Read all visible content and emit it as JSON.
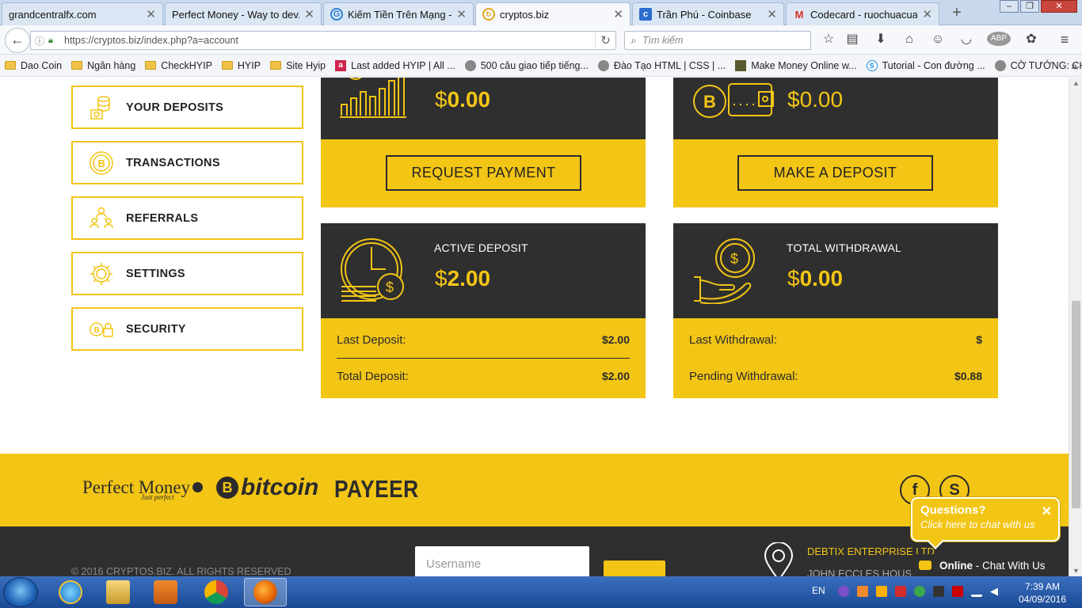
{
  "browser": {
    "tabs": [
      {
        "label": "grandcentralfx.com",
        "icon": "blank-page-icon"
      },
      {
        "label": "Perfect Money - Way to dev...",
        "icon": "blank-page-icon"
      },
      {
        "label": "Kiếm Tiền Trên Mạng - ...",
        "icon": "kiem-tien-site-icon"
      },
      {
        "label": "cryptos.biz",
        "icon": "loading-icon"
      },
      {
        "label": "Trần Phú - Coinbase",
        "icon": "coinbase-icon"
      },
      {
        "label": "Codecard - ruochuacua...",
        "icon": "gmail-icon"
      }
    ],
    "url": "https://cryptos.biz/index.php?a=account",
    "search_placeholder": "Tìm kiếm",
    "bookmarks": [
      {
        "label": "Dao Coin",
        "icon": "folder-icon"
      },
      {
        "label": "Ngân hàng",
        "icon": "folder-icon"
      },
      {
        "label": "CheckHYIP",
        "icon": "folder-icon"
      },
      {
        "label": "HYIP",
        "icon": "folder-icon"
      },
      {
        "label": "Site Hyip",
        "icon": "folder-icon"
      },
      {
        "label": "Last added HYIP | All ...",
        "icon": "site-red-icon"
      },
      {
        "label": "500 câu giao tiếp tiếng...",
        "icon": "globe-icon"
      },
      {
        "label": "Đào Tạo HTML | CSS | ...",
        "icon": "globe-icon"
      },
      {
        "label": "Make Money Online w...",
        "icon": "site-dark-icon"
      },
      {
        "label": "Tutorial - Con đường ...",
        "icon": "site-blue-icon"
      },
      {
        "label": "CỜ TƯỚNG: CHUYÊN ...",
        "icon": "globe-icon"
      }
    ]
  },
  "sidebar": {
    "items": [
      {
        "label": "YOUR DEPOSITS",
        "icon": "coins-stack-icon"
      },
      {
        "label": "TRANSACTIONS",
        "icon": "bitcoin-coin-icon"
      },
      {
        "label": "REFERRALS",
        "icon": "referral-people-icon"
      },
      {
        "label": "SETTINGS",
        "icon": "gear-icon"
      },
      {
        "label": "SECURITY",
        "icon": "lock-coin-icon"
      }
    ]
  },
  "panels": {
    "top_left": {
      "currency": "$",
      "amount": "0.00",
      "button": "REQUEST PAYMENT",
      "icon": "growth-chart-icon"
    },
    "top_right": {
      "currency": "$",
      "amount": "0.00",
      "button": "MAKE A DEPOSIT",
      "icon": "bitcoin-wallet-icon"
    },
    "active_deposit": {
      "title": "ACTIVE DEPOSIT",
      "currency": "$",
      "amount": "2.00",
      "icon": "clock-money-icon",
      "rows": [
        {
          "label": "Last Deposit:",
          "value": "$2.00"
        },
        {
          "label": "Total Deposit:",
          "value": "$2.00"
        }
      ]
    },
    "total_withdrawal": {
      "title": "TOTAL WITHDRAWAL",
      "currency": "$",
      "amount": "0.00",
      "icon": "hand-coin-icon",
      "rows": [
        {
          "label": "Last Withdrawal:",
          "value": "$"
        },
        {
          "label": "Pending Withdrawal:",
          "value": "$0.88"
        }
      ]
    }
  },
  "footer": {
    "payments": {
      "perfect_money": "Perfect Money",
      "perfect_money_sub": "Just perfect",
      "bitcoin": "bitcoin",
      "payeer": "PAYEER"
    },
    "copyright": "© 2016 CRYPTOS.BIZ. ALL RIGHTS RESERVED",
    "username_placeholder": "Username",
    "company": "DEBTIX ENTERPRISE LTD",
    "address": "JOHN ECCLES HOUSE"
  },
  "chat": {
    "question_title": "Questions?",
    "question_sub": "Click here to chat with us",
    "status": "Online",
    "status_text": " - Chat With Us"
  },
  "taskbar": {
    "lang": "EN",
    "time": "7:39 AM",
    "date": "04/09/2016"
  },
  "colors": {
    "accent": "#f3c515",
    "dark": "#2f2f2f"
  }
}
